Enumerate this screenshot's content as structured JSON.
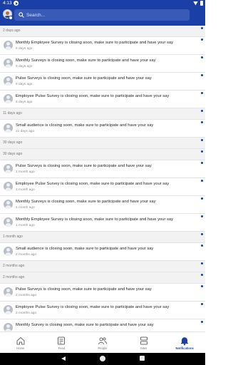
{
  "status_bar": {
    "time": "4:13"
  },
  "search": {
    "placeholder": "Search..."
  },
  "colors": {
    "brand": "#1a3fa6",
    "unread_dot": "#1a3fa6",
    "group_bg": "#f2f2f3"
  },
  "groups": [
    {
      "header": "2 days ago",
      "items": [
        {
          "message": "Monthly Employee Survey is closing soon, make sure to participate and have your say",
          "time": "6 days ago"
        },
        {
          "message": "Monthly Surveys is closing soon, make sure to participate and have your say",
          "time": "6 days ago"
        },
        {
          "message": "Pulse Surveys is closing soon, make sure to participate and have your say",
          "time": "6 days ago"
        },
        {
          "message": "Employee Pulse Survey is closing soon, make sure to participate and have your say",
          "time": "6 days ago"
        }
      ]
    },
    {
      "header": "11 days ago",
      "items": [
        {
          "message": "Small audience is closing soon, make sure to participate and have your say",
          "time": "21 days ago"
        }
      ]
    },
    {
      "header": "30 days ago",
      "items": []
    },
    {
      "header": "30 days ago",
      "items": [
        {
          "message": "Pulse Surveys is closing soon, make sure to participate and have your say",
          "time": "1 month ago"
        },
        {
          "message": "Employee Pulse Survey is closing soon, make sure to participate and have your say",
          "time": "1 month ago"
        },
        {
          "message": "Monthly Surveys is closing soon, make sure to participate and have your say",
          "time": "1 month ago"
        },
        {
          "message": "Monthly Employee Survey is closing soon, make sure to participate and have your say",
          "time": "1 month ago"
        }
      ]
    },
    {
      "header": "1 month ago",
      "items": [
        {
          "message": "Small audience is closing soon, make sure to participate and have your say",
          "time": "2 months ago"
        }
      ]
    },
    {
      "header": "2 months ago",
      "items": []
    },
    {
      "header": "2 months ago",
      "items": [
        {
          "message": "Pulse Surveys is closing soon, make sure to participate and have your say",
          "time": "2 months ago"
        },
        {
          "message": "Employee Pulse Survey is closing soon, make sure to participate and have your say",
          "time": "2 months ago"
        },
        {
          "message": "Monthly Survey is closing soon, make sure to participate and have your say",
          "time": ""
        }
      ]
    }
  ],
  "nav": [
    {
      "label": "Home",
      "icon": "home-icon",
      "active": false
    },
    {
      "label": "Feed",
      "icon": "feed-icon",
      "active": false
    },
    {
      "label": "People",
      "icon": "people-icon",
      "active": false
    },
    {
      "label": "Sites",
      "icon": "sites-icon",
      "active": false
    },
    {
      "label": "Notifications",
      "icon": "bell-icon",
      "active": true
    }
  ]
}
